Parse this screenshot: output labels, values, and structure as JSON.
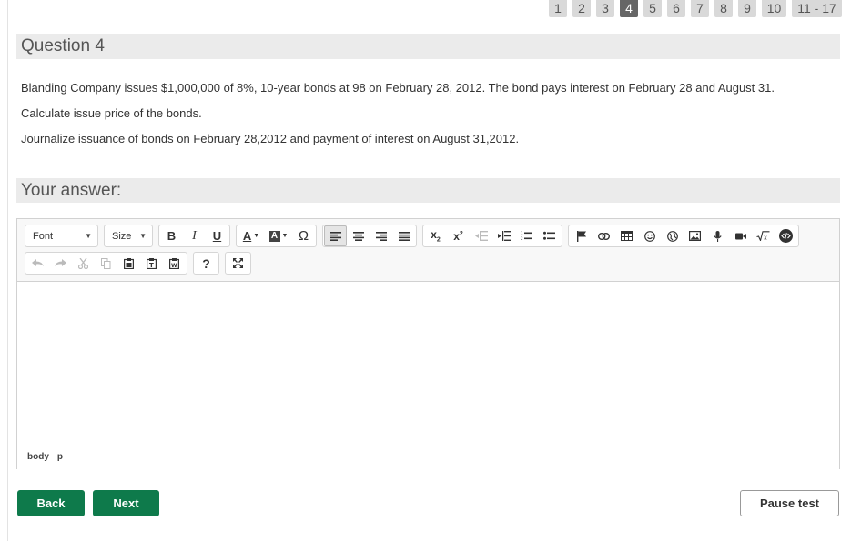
{
  "pagination": {
    "pages": [
      "1",
      "2",
      "3",
      "4",
      "5",
      "6",
      "7",
      "8",
      "9",
      "10"
    ],
    "active": "4",
    "range_label": "11 - 17"
  },
  "question": {
    "title": "Question 4",
    "lines": [
      "Blanding Company issues $1,000,000 of 8%, 10-year bonds at 98 on February 28, 2012.  The bond pays interest on February 28 and August 31.",
      "Calculate issue price of the bonds.",
      "Journalize issuance of bonds on February 28,2012 and payment of interest on August 31,2012."
    ]
  },
  "answer": {
    "title": "Your answer:",
    "editor": {
      "font_label": "Font",
      "size_label": "Size",
      "bold": "B",
      "italic": "I",
      "underline": "U",
      "omega": "Ω",
      "help": "?",
      "path": [
        "body",
        "p"
      ]
    }
  },
  "buttons": {
    "back": "Back",
    "next": "Next",
    "pause": "Pause test"
  },
  "colors": {
    "primary": "#0e7a4b",
    "active_page": "#666666",
    "page_chip": "#d9d9d9",
    "section_bar": "#ebebeb"
  }
}
